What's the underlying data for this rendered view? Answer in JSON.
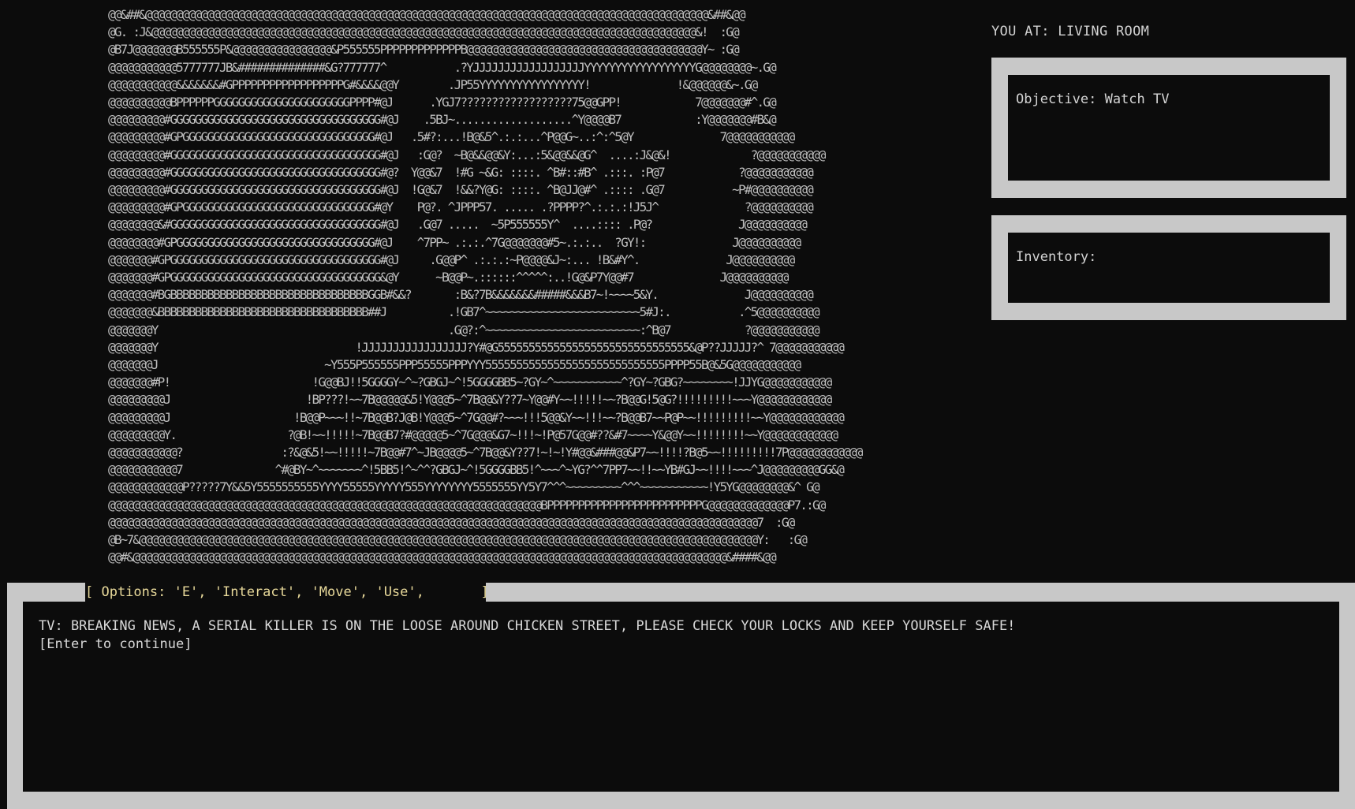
{
  "location": "YOU AT: LIVING ROOM",
  "objective": "Objective: Watch TV",
  "inventory": "Inventory:",
  "options_bar": "[ Options: 'E', 'Interact', 'Move', 'Use',       ]",
  "dialog": {
    "message": "TV: BREAKING NEWS, A SERIAL KILLER IS ON THE LOOSE AROUND CHICKEN STREET, PLEASE CHECK YOUR LOCKS AND KEEP YOURSELF SAFE!",
    "continue_hint": "[Enter to continue]"
  },
  "ascii_art": "@@&##&@@@@@@@@@@@@@@@@@@@@@@@@@@@@@@@@@@@@@@@@@@@@@@@@@@@@@@@@@@@@@@@@@@@@@@@@@@@@@@@@@@@@@@@@@@@&##&@@\n@G. :J&@@@@@@@@@@@@@@@@@@@@@@@@@@@@@@@@@@@@@@@@@@@@@@@@@@@@@@@@@@@@@@@@@@@@@@@@@@@@@@@@@@@@@@@@&!  :G@\n@B7J@@@@@@@B555555P&@@@@@@@@@@@@@@@@&P555555PPPPPPPPPPPPPB@@@@@@@@@@@@@@@@@@@@@@@@@@@@@@@@@@@@@@Y~ :G@\n@@@@@@@@@@@5777777JB&##############&G?777777^           .?YJJJJJJJJJJJJJJJJJJYYYYYYYYYYYYYYYYYYG@@@@@@@@~.G@\n@@@@@@@@@@@&&&&&&&#GPPPPPPPPPPPPPPPPPPG#&&&&@@Y        .JP55YYYYYYYYYYYYYYYYY!              !&@@@@@@&~.G@\n@@@@@@@@@@BPPPPPPGGGGGGGGGGGGGGGGGGGGGGPPPP#@J      .YGJ7??????????????????75@@GPP!            7@@@@@@@#^.G@\n@@@@@@@@@#GGGGGGGGGGGGGGGGGGGGGGGGGGGGGGGGGG#@J    .5BJ~...................^Y@@@@B7            :Y@@@@@@@#B&@\n@@@@@@@@@#GPGGGGGGGGGGGGGGGGGGGGGGGGGGGGGGG#@J   .5#?:...!B@&5^.:.:...^P@@G~..:^:^5@Y              7@@@@@@@@@@@\n@@@@@@@@@#GGGGGGGGGGGGGGGGGGGGGGGGGGGGGGGGGG#@J   :G@?  ~B@&&@@&Y:...:5&@@&&@G^  ....:J&@&!             ?@@@@@@@@@@@\n@@@@@@@@@#GGGGGGGGGGGGGGGGGGGGGGGGGGGGGGGGGG#@?  Y@@&7  !#G ~&G: ::::. ^B#::#B^ .:::. :P@7            ?@@@@@@@@@@@\n@@@@@@@@@#GGGGGGGGGGGGGGGGGGGGGGGGGGGGGGGGGG#@J  !G@&7  !&&?Y@G: ::::. ^B@JJ@#^ .:::: .G@7           ~P#@@@@@@@@@@\n@@@@@@@@@#GPGGGGGGGGGGGGGGGGGGGGGGGGGGGGGGG#@Y    P@?. ^JPPP57. ..... .?PPPP?^.:.:.:!J5J^              ?@@@@@@@@@@\n@@@@@@@@&#GGGGGGGGGGGGGGGGGGGGGGGGGGGGGGGGGG#@J   .G@7 .....  ~5P555555Y^  ....:::: .P@?              J@@@@@@@@@@\n@@@@@@@@#GPGGGGGGGGGGGGGGGGGGGGGGGGGGGGGGGG#@J    ^7PP~ .:.:.^7G@@@@@@@#5~.:.:..  ?GY!:              J@@@@@@@@@@\n@@@@@@@#GPGGGGGGGGGGGGGGGGGGGGGGGGGGGGGGGGGG#@J     .G@@P^ .:.:.:~P@@@@&J~:... !B&#Y^.              J@@@@@@@@@@\n@@@@@@@#GPGGGGGGGGGGGGGGGGGGGGGGGGGGGGGGGGGG&@Y      ~B@@P~.::::::^^^^^:..!G@&P7Y@@#7              J@@@@@@@@@@\n@@@@@@@#BGBBBBBBBBBBBBBBBBBBBBBBBBBBBBBBBBGGB#&&?       :B&?7B&&&&&&&#####&&&B7~!~~~~5&Y.              J@@@@@@@@@@\n@@@@@@@&BBBBBBBBBBBBBBBBBBBBBBBBBBBBBBBBBB##J          .!GB7^~~~~~~~~~~~~~~~~~~~~~~~~~5#J:.           .^5@@@@@@@@@@\n@@@@@@@Y                                               .G@?:^~~~~~~~~~~~~~~~~~~~~~~~~~:^B@7            ?@@@@@@@@@@@\n@@@@@@@Y                                !JJJJJJJJJJJJJJJJJ?Y#@G5555555555555555555555555555555&@P??JJJJJ?^ 7@@@@@@@@@@@\n@@@@@@@J                           ~Y555P555555PPP55555PPPYYY55555555555555555555555555555PPPP55B@&5G@@@@@@@@@@@\n@@@@@@@#P!                       !G@@BJ!!5GGGGY~^~?GBGJ~^!5GGGGBB5~?GY~^~~~~~~~~~~~^?GY~?GBG?~~~~~~~~!JJYG@@@@@@@@@@@\n@@@@@@@@@J                      !BP???!~~7B@@@@@&5!Y@@@5~^7B@@&Y??7~Y@@#Y~~!!!!!~~?B@@G!5@G?!!!!!!!!!~~~Y@@@@@@@@@@@@\n@@@@@@@@@J                    !B@@P~~~!!~7B@@B?J@B!Y@@@5~^7G@@#?~~~!!!5@@&Y~~!!!~~?B@@B7~~P@P~~!!!!!!!!!~~Y@@@@@@@@@@@@\n@@@@@@@@@Y.                  ?@B!~~!!!!!~7B@@B7?#@@@@@5~^7G@@@&G7~!!!~!P@57G@@#??&#7~~~~Y&@@Y~~!!!!!!!!~~Y@@@@@@@@@@@@\n@@@@@@@@@@@?                :?&@&5!~~!!!!!~7B@@#7^~JB@@@@5~^7B@@&Y??7!~!~!Y#@@&###@@&P7~~!!!!?B@5~~!!!!!!!!!7P@@@@@@@@@@@@\n@@@@@@@@@@@7               ^#@BY~^~~~~~~~^!5BB5!^~^^?GBGJ~^!5GGGGBB5!^~~~^~YG?^^7PP7~~!!~~YB#GJ~~!!!!~~~^J@@@@@@@@@GG&@\n@@@@@@@@@@@@P?????7Y&&5Y5555555555YYYY55555YYYYY555YYYYYYYY5555555YY5Y7^^^~~~~~~~~~^^^~~~~~~~~~~~!Y5YG@@@@@@@@&^ G@\n@@@@@@@@@@@@@@@@@@@@@@@@@@@@@@@@@@@@@@@@@@@@@@@@@@@@@@@@@@@@@@@@@@@@@@BPPPPPPPPPPPPPPPPPPPPPPPPPG@@@@@@@@@@@@@P7.:G@\n@@@@@@@@@@@@@@@@@@@@@@@@@@@@@@@@@@@@@@@@@@@@@@@@@@@@@@@@@@@@@@@@@@@@@@@@@@@@@@@@@@@@@@@@@@@@@@@@@@@@@@@@@7  :G@\n@B~7&@@@@@@@@@@@@@@@@@@@@@@@@@@@@@@@@@@@@@@@@@@@@@@@@@@@@@@@@@@@@@@@@@@@@@@@@@@@@@@@@@@@@@@@@@@@@@@@@@@@@Y:   :G@\n@@#&@@@@@@@@@@@@@@@@@@@@@@@@@@@@@@@@@@@@@@@@@@@@@@@@@@@@@@@@@@@@@@@@@@@@@@@@@@@@@@@@@@@@@@@@@@@@@@@@&####&@@"
}
